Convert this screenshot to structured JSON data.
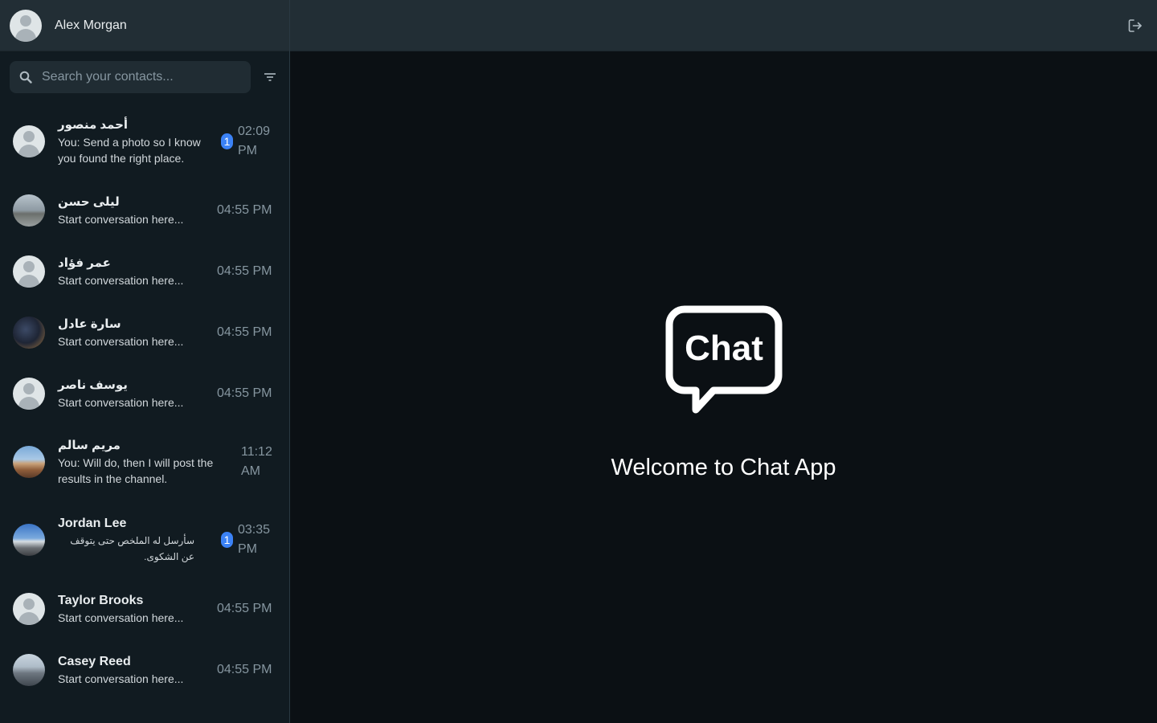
{
  "user": {
    "name": "Alex Morgan",
    "avatar_icon": "default-avatar-icon"
  },
  "search": {
    "placeholder": "Search your contacts..."
  },
  "contacts": [
    {
      "name": "أحمد منصور",
      "preview": "You: Send a photo so I know you found the right place.",
      "time": "02:09 PM",
      "unread": "1",
      "avatar": "default"
    },
    {
      "name": "ليلى حسن",
      "preview": "Start conversation here...",
      "time": "04:55 PM",
      "avatar": "beach-photo"
    },
    {
      "name": "عمر فؤاد",
      "preview": "Start conversation here...",
      "time": "04:55 PM",
      "avatar": "default"
    },
    {
      "name": "سارة عادل",
      "preview": "Start conversation here...",
      "time": "04:55 PM",
      "avatar": "night-photo"
    },
    {
      "name": "يوسف ناصر",
      "preview": "Start conversation here...",
      "time": "04:55 PM",
      "avatar": "default"
    },
    {
      "name": "مريم سالم",
      "preview": "You: Will do, then I will post the results in the channel.",
      "time": "11:12 AM",
      "avatar": "canyon-photo"
    },
    {
      "name": "Jordan Lee",
      "preview": "سأرسل له الملخص حتى يتوقف عن الشكوى.",
      "time": "03:35 PM",
      "unread": "1",
      "avatar": "road-photo"
    },
    {
      "name": "Taylor Brooks",
      "preview": "Start conversation here...",
      "time": "04:55 PM",
      "avatar": "default"
    },
    {
      "name": "Casey Reed",
      "preview": "Start conversation here...",
      "time": "04:55 PM",
      "avatar": "mountain-photo"
    }
  ],
  "welcome": {
    "logo_text": "Chat",
    "message": "Welcome to Chat App"
  },
  "icons": {
    "search": "search-icon",
    "filter": "filter-icon",
    "logout": "logout-icon"
  },
  "colors": {
    "sidebar_bg": "#111b21",
    "header_bg": "#222e35",
    "main_bg": "#0b1014",
    "badge": "#3b82f6",
    "muted_text": "#8696a0"
  }
}
